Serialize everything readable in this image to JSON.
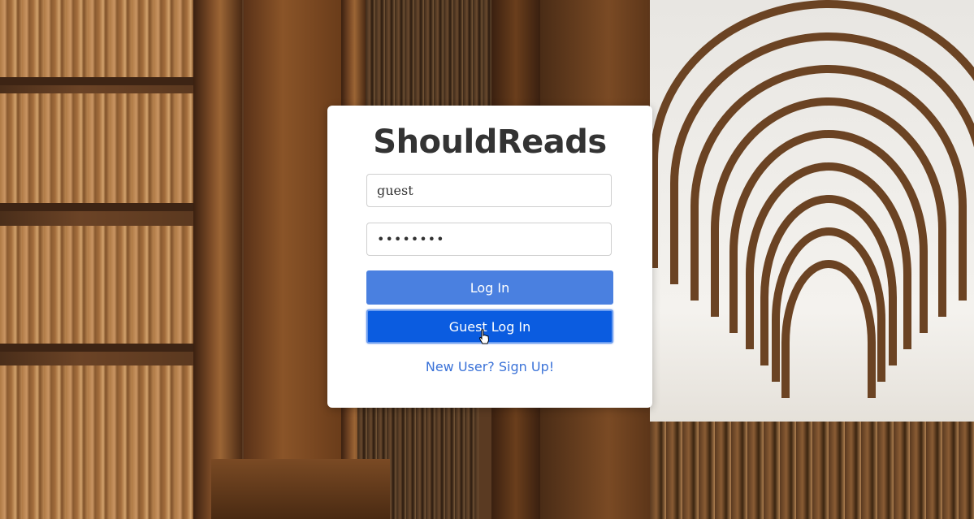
{
  "app": {
    "title": "ShouldReads"
  },
  "login_form": {
    "username_value": "guest",
    "password_value": "guestpwd",
    "login_label": "Log In",
    "guest_login_label": "Guest Log In",
    "signup_link_label": "New User? Sign Up!"
  },
  "colors": {
    "login_button": "#4a80e0",
    "guest_button": "#0b5ce0",
    "link": "#3a72d8",
    "title": "#333333"
  },
  "icons": {
    "cursor": "pointer-hand-cursor-icon"
  }
}
